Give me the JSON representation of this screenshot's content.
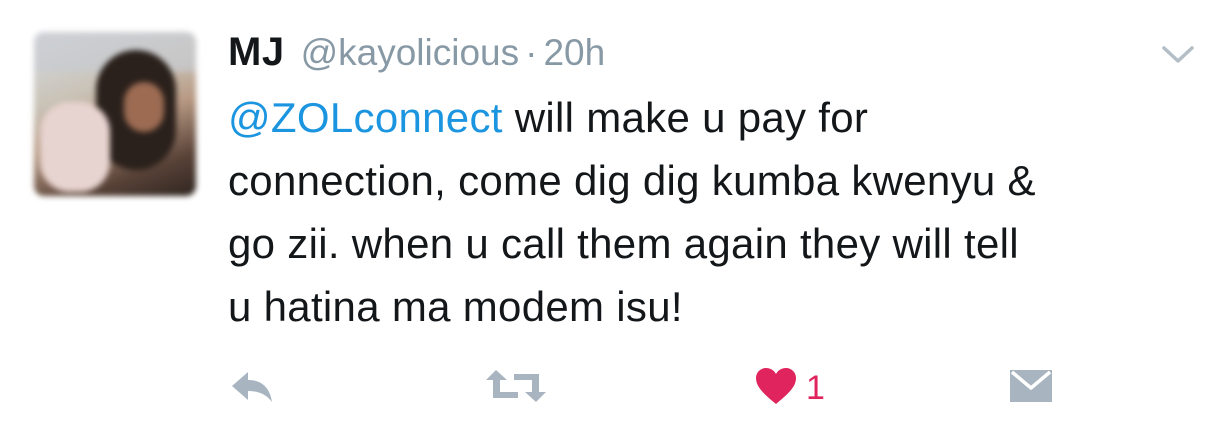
{
  "tweet": {
    "display_name": "MJ",
    "handle": "@kayolicious",
    "separator": "·",
    "time": "20h",
    "mention": "@ZOLconnect",
    "text": " will make u pay for\nconnection, come dig dig kumba kwenyu &\ngo zii. when u call them again they will tell\nu hatina ma modem isu!"
  },
  "actions": {
    "reply_icon": "reply-icon",
    "retweet_icon": "retweet-icon",
    "like_icon": "heart-icon",
    "like_count": "1",
    "dm_icon": "envelope-icon"
  },
  "colors": {
    "text": "#14171a",
    "muted": "#8899a6",
    "mention": "#1b95e0",
    "like": "#e0245e",
    "icon": "#a8b5c0"
  }
}
